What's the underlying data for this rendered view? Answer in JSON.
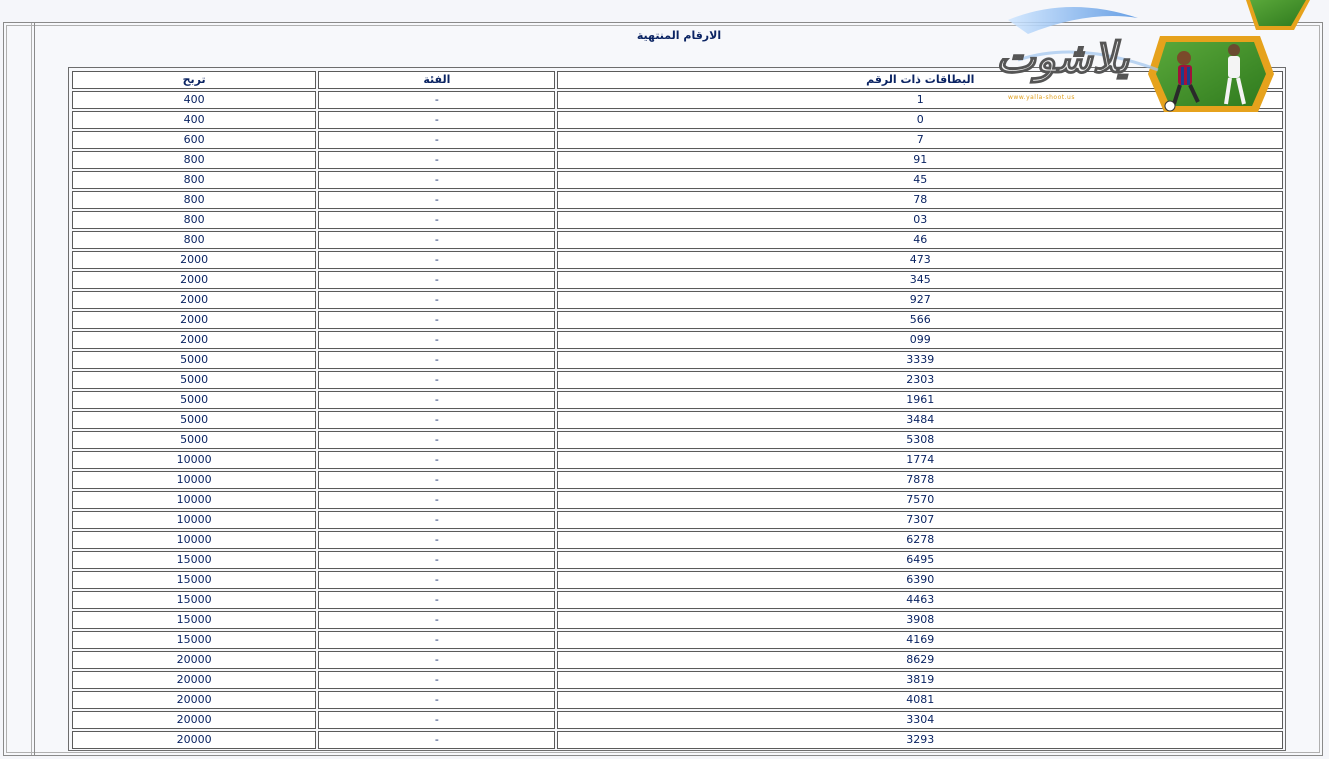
{
  "page": {
    "title": "الارقام المنتهية"
  },
  "logo": {
    "url_text": "www.yalla-shoot.us"
  },
  "table": {
    "headers": {
      "prize": "تربح",
      "category": "الفئة",
      "cards": "البطاقات ذات الرقم"
    },
    "rows": [
      {
        "prize": "400",
        "category": "-",
        "number": "1"
      },
      {
        "prize": "400",
        "category": "-",
        "number": "0"
      },
      {
        "prize": "600",
        "category": "-",
        "number": "7"
      },
      {
        "prize": "800",
        "category": "-",
        "number": "91"
      },
      {
        "prize": "800",
        "category": "-",
        "number": "45"
      },
      {
        "prize": "800",
        "category": "-",
        "number": "78"
      },
      {
        "prize": "800",
        "category": "-",
        "number": "03"
      },
      {
        "prize": "800",
        "category": "-",
        "number": "46"
      },
      {
        "prize": "2000",
        "category": "-",
        "number": "473"
      },
      {
        "prize": "2000",
        "category": "-",
        "number": "345"
      },
      {
        "prize": "2000",
        "category": "-",
        "number": "927"
      },
      {
        "prize": "2000",
        "category": "-",
        "number": "566"
      },
      {
        "prize": "2000",
        "category": "-",
        "number": "099"
      },
      {
        "prize": "5000",
        "category": "-",
        "number": "3339"
      },
      {
        "prize": "5000",
        "category": "-",
        "number": "2303"
      },
      {
        "prize": "5000",
        "category": "-",
        "number": "1961"
      },
      {
        "prize": "5000",
        "category": "-",
        "number": "3484"
      },
      {
        "prize": "5000",
        "category": "-",
        "number": "5308"
      },
      {
        "prize": "10000",
        "category": "-",
        "number": "1774"
      },
      {
        "prize": "10000",
        "category": "-",
        "number": "7878"
      },
      {
        "prize": "10000",
        "category": "-",
        "number": "7570"
      },
      {
        "prize": "10000",
        "category": "-",
        "number": "7307"
      },
      {
        "prize": "10000",
        "category": "-",
        "number": "6278"
      },
      {
        "prize": "15000",
        "category": "-",
        "number": "6495"
      },
      {
        "prize": "15000",
        "category": "-",
        "number": "6390"
      },
      {
        "prize": "15000",
        "category": "-",
        "number": "4463"
      },
      {
        "prize": "15000",
        "category": "-",
        "number": "3908"
      },
      {
        "prize": "15000",
        "category": "-",
        "number": "4169"
      },
      {
        "prize": "20000",
        "category": "-",
        "number": "8629"
      },
      {
        "prize": "20000",
        "category": "-",
        "number": "3819"
      },
      {
        "prize": "20000",
        "category": "-",
        "number": "4081"
      },
      {
        "prize": "20000",
        "category": "-",
        "number": "3304"
      },
      {
        "prize": "20000",
        "category": "-",
        "number": "3293"
      }
    ]
  },
  "colors": {
    "text": "#0b2463",
    "background": "#f5f6fa",
    "cell": "#ffffff",
    "border": "#5a5a5a"
  }
}
